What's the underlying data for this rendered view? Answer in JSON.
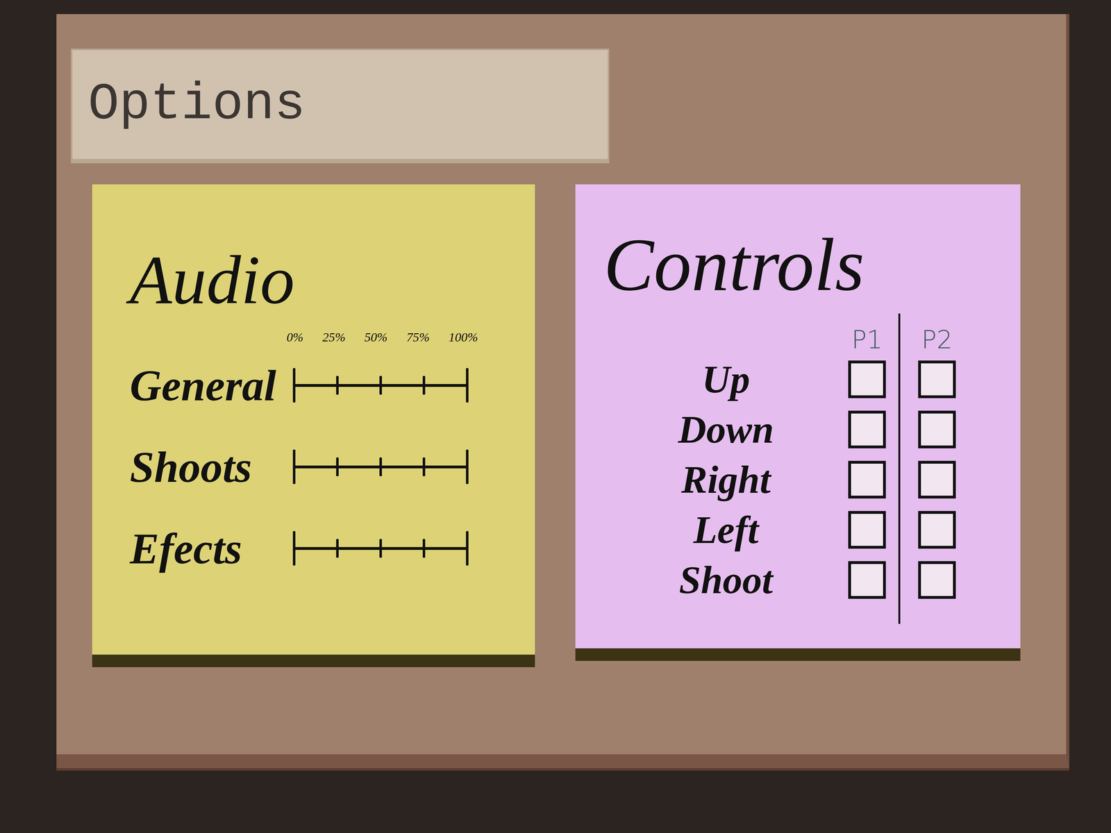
{
  "window": {
    "title": "Options"
  },
  "audio": {
    "title": "Audio",
    "scale": [
      "0%",
      "25%",
      "50%",
      "75%",
      "100%"
    ],
    "sliders": [
      {
        "label": "General"
      },
      {
        "label": "Shoots"
      },
      {
        "label": "Efects"
      }
    ]
  },
  "controls": {
    "title": "Controls",
    "players": [
      "P1",
      "P2"
    ],
    "rows": [
      {
        "label": "Up",
        "checked": [
          false,
          false
        ]
      },
      {
        "label": "Down",
        "checked": [
          false,
          false
        ]
      },
      {
        "label": "Right",
        "checked": [
          false,
          false
        ]
      },
      {
        "label": "Left",
        "checked": [
          false,
          false
        ]
      },
      {
        "label": "Shoot",
        "checked": [
          false,
          false
        ]
      }
    ]
  }
}
